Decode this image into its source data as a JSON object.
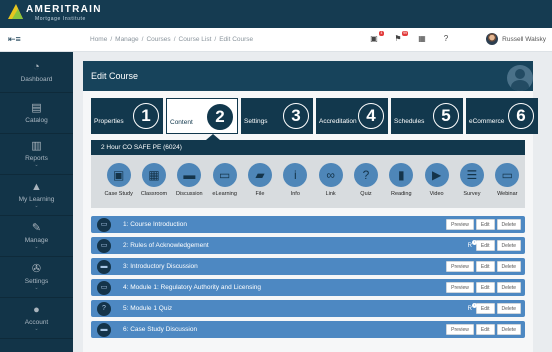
{
  "brand": {
    "name": "AMERITRAIN",
    "subtitle": "Mortgage Institute"
  },
  "breadcrumb": [
    "Home",
    "Manage",
    "Courses",
    "Course List",
    "Edit Course"
  ],
  "header_icons": [
    {
      "icon": "bell-icon",
      "badge": "4"
    },
    {
      "icon": "flag-icon",
      "badge": "99"
    },
    {
      "icon": "inbox-icon",
      "badge": ""
    },
    {
      "icon": "help-icon",
      "badge": ""
    }
  ],
  "user": {
    "name": "Russell Walsky"
  },
  "sidebar": {
    "items": [
      {
        "label": "Dashboard",
        "icon": "dashboard-icon",
        "glyph": "◔",
        "chevron": ""
      },
      {
        "label": "Catalog",
        "icon": "catalog-icon",
        "glyph": "▤",
        "chevron": ""
      },
      {
        "label": "Reports",
        "icon": "reports-icon",
        "glyph": "▥",
        "chevron": "⌄"
      },
      {
        "label": "My Learning",
        "icon": "learning-icon",
        "glyph": "▲",
        "chevron": "⌄"
      },
      {
        "label": "Manage",
        "icon": "manage-icon",
        "glyph": "✎",
        "chevron": "⌄"
      },
      {
        "label": "Settings",
        "icon": "wrench-icon",
        "glyph": "✇",
        "chevron": "⌄"
      },
      {
        "label": "Account",
        "icon": "account-icon",
        "glyph": "●",
        "chevron": "⌄"
      }
    ]
  },
  "page": {
    "title": "Edit Course"
  },
  "tabs": [
    {
      "label": "Properties",
      "num": "1"
    },
    {
      "label": "Content",
      "num": "2",
      "active": true
    },
    {
      "label": "Settings",
      "num": "3"
    },
    {
      "label": "Accreditation",
      "num": "4"
    },
    {
      "label": "Schedules",
      "num": "5"
    },
    {
      "label": "eCommerce",
      "num": "6"
    }
  ],
  "course": {
    "title": "2 Hour CO SAFE PE (6024)"
  },
  "content_types": [
    {
      "label": "Case Study",
      "glyph": "▣"
    },
    {
      "label": "Classroom",
      "glyph": "▦"
    },
    {
      "label": "Discussion",
      "glyph": "▬"
    },
    {
      "label": "eLearning",
      "glyph": "▭"
    },
    {
      "label": "File",
      "glyph": "▰"
    },
    {
      "label": "Info",
      "glyph": "i"
    },
    {
      "label": "Link",
      "glyph": "∞"
    },
    {
      "label": "Quiz",
      "glyph": "?"
    },
    {
      "label": "Reading",
      "glyph": "▮"
    },
    {
      "label": "Video",
      "glyph": "▶"
    },
    {
      "label": "Survey",
      "glyph": "☰"
    },
    {
      "label": "Webinar",
      "glyph": "▭"
    }
  ],
  "items": [
    {
      "title": "1: Course Introduction",
      "glyph": "▭",
      "flag": "",
      "buttons": [
        "Preview",
        "Edit",
        "Delete"
      ]
    },
    {
      "title": "2: Rules of Acknowledgement",
      "glyph": "▭",
      "flag": "R",
      "buttons": [
        "Edit",
        "Delete"
      ]
    },
    {
      "title": "3: Introductory Discussion",
      "glyph": "▬",
      "flag": "",
      "buttons": [
        "Preview",
        "Edit",
        "Delete"
      ]
    },
    {
      "title": "4: Module 1: Regulatory Authority and Licensing",
      "glyph": "▭",
      "flag": "",
      "buttons": [
        "Preview",
        "Edit",
        "Delete"
      ]
    },
    {
      "title": "5: Module 1 Quiz",
      "glyph": "?",
      "flag": "R",
      "buttons": [
        "Edit",
        "Delete"
      ]
    },
    {
      "title": "6: Case Study Discussion",
      "glyph": "▬",
      "flag": "",
      "buttons": [
        "Preview",
        "Edit",
        "Delete"
      ]
    }
  ]
}
